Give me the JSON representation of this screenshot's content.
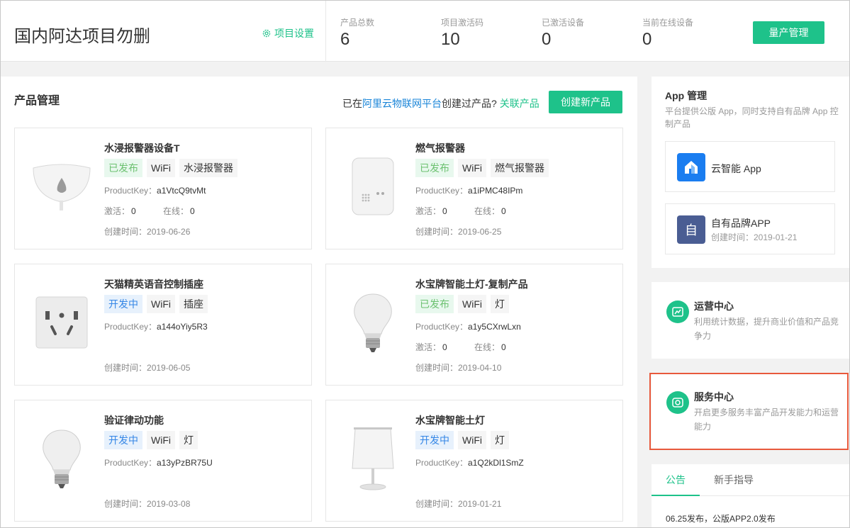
{
  "header": {
    "project_title": "国内阿达项目勿删",
    "settings_label": "项目设置",
    "stats": [
      {
        "label": "产品总数",
        "value": "6"
      },
      {
        "label": "项目激活码",
        "value": "10"
      },
      {
        "label": "已激活设备",
        "value": "0"
      },
      {
        "label": "当前在线设备",
        "value": "0"
      }
    ],
    "mass_production_label": "量产管理"
  },
  "products": {
    "title": "产品管理",
    "hint_prefix": "已在",
    "hint_link": "阿里云物联网平台",
    "hint_suffix": "创建过产品?",
    "link_label": "关联产品",
    "create_label": "创建新产品",
    "key_label": "ProductKey：",
    "activated_label": "激活：",
    "online_label": "在线：",
    "created_label": "创建时间：",
    "items": [
      {
        "name": "水浸报警器设备T",
        "status": "已发布",
        "net": "WiFi",
        "category": "水浸报警器",
        "key": "a1VtcQ9tvMt",
        "activated": "0",
        "online": "0",
        "created": "2019-06-26"
      },
      {
        "name": "燃气报警器",
        "status": "已发布",
        "net": "WiFi",
        "category": "燃气报警器",
        "key": "a1iPMC48IPm",
        "activated": "0",
        "online": "0",
        "created": "2019-06-25"
      },
      {
        "name": "天猫精英语音控制插座",
        "status": "开发中",
        "net": "WiFi",
        "category": "插座",
        "key": "a144oYiy5R3",
        "created": "2019-06-05"
      },
      {
        "name": "水宝牌智能土灯-复制产品",
        "status": "已发布",
        "net": "WiFi",
        "category": "灯",
        "key": "a1y5CXrwLxn",
        "activated": "0",
        "online": "0",
        "created": "2019-04-10"
      },
      {
        "name": "验证律动功能",
        "status": "开发中",
        "net": "WiFi",
        "category": "灯",
        "key": "a13yPzBR75U",
        "created": "2019-03-08"
      },
      {
        "name": "水宝牌智能土灯",
        "status": "开发中",
        "net": "WiFi",
        "category": "灯",
        "key": "a1Q2kDl1SmZ",
        "created": "2019-01-21"
      }
    ]
  },
  "app_panel": {
    "title": "App 管理",
    "desc": "平台提供公版 App，同时支持自有品牌 App 控制产品",
    "apps": [
      {
        "name": "云智能 App"
      },
      {
        "icon_text": "自",
        "name": "自有品牌APP",
        "created": "创建时间：2019-01-21"
      }
    ]
  },
  "operations": {
    "title": "运营中心",
    "desc": "利用统计数据，提升商业价值和产品竞争力"
  },
  "services": {
    "title": "服务中心",
    "desc": "开启更多服务丰富产品开发能力和运营能力"
  },
  "news": {
    "tabs": [
      "公告",
      "新手指导"
    ],
    "items": [
      "06.25发布，公版APP2.0发布"
    ]
  },
  "colors": {
    "accent": "#1ec28a",
    "link": "#1a85d8",
    "highlight": "#e8593c"
  }
}
